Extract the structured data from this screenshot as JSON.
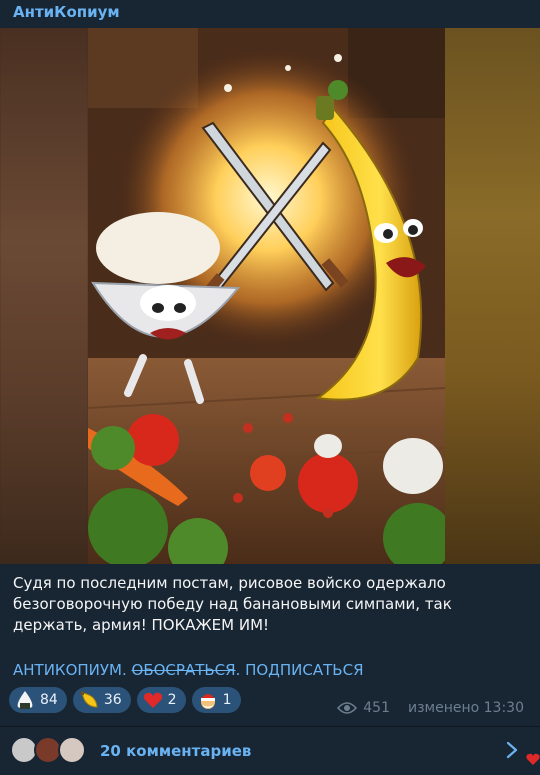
{
  "channel": {
    "name": "АнтиКопиум"
  },
  "post": {
    "caption": "Судя по последним постам, рисовое войско одержало безоговорочную победу над банановыми симпами, так держать, армия! ПОКАЖЕМ ИМ!",
    "links": {
      "first": "АНТИКОПИУМ.",
      "second": "ОБОСРАТЬСЯ",
      "third": ". ПОДПИСАТЬСЯ"
    },
    "reactions": [
      {
        "icon": "rice-ball-icon",
        "count": "84"
      },
      {
        "icon": "banana-icon",
        "count": "36"
      },
      {
        "icon": "heart-icon",
        "count": "2"
      },
      {
        "icon": "santa-icon",
        "count": "1"
      }
    ],
    "views": "451",
    "edited": "изменено 13:30"
  },
  "comments": {
    "label": "20 комментариев"
  },
  "colors": {
    "accent": "#6ab3f3",
    "bubble": "#182533",
    "reaction_bg": "#2b5278"
  }
}
